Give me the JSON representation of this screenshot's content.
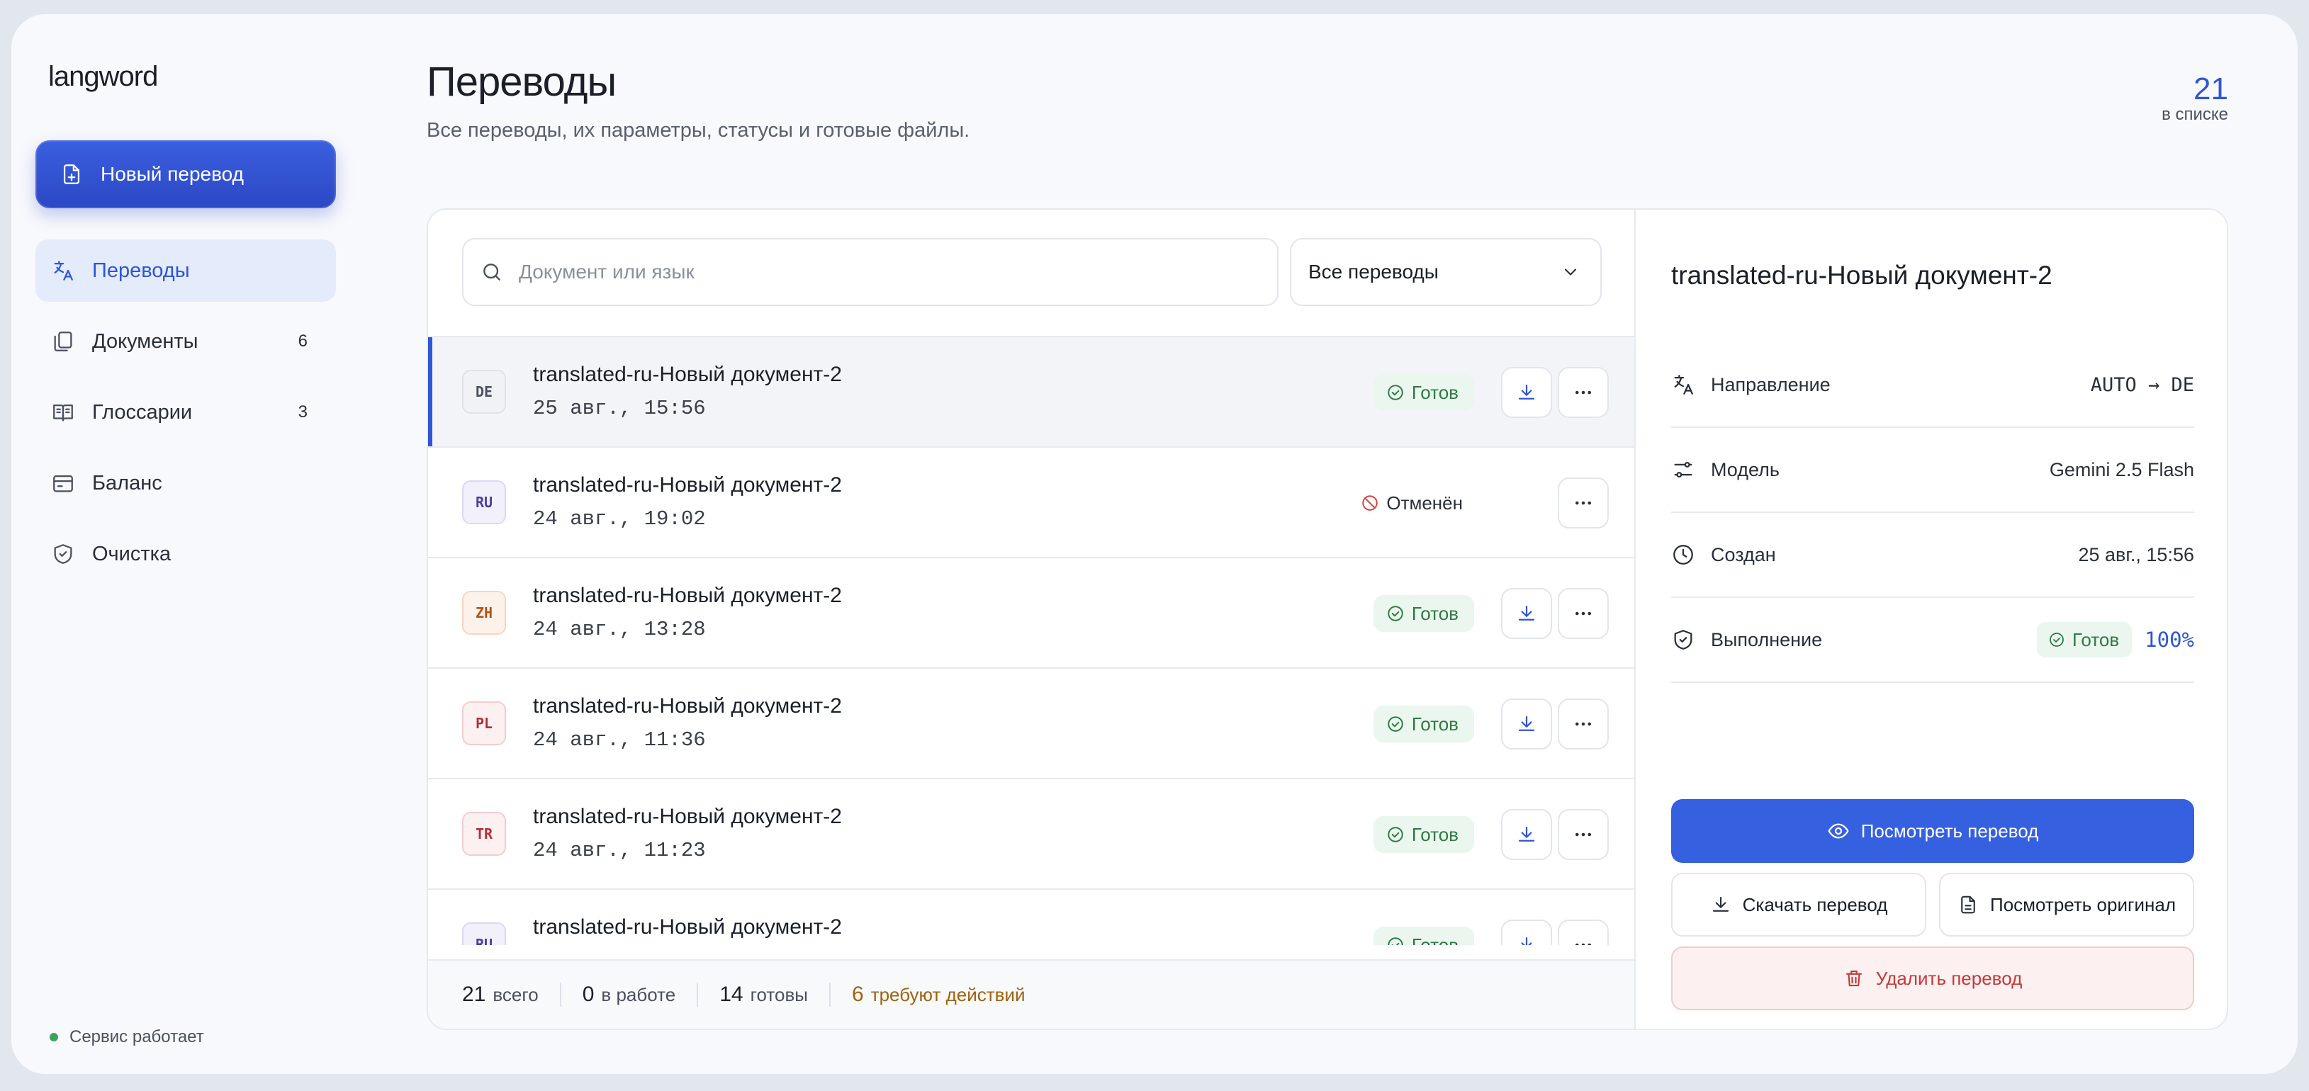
{
  "app": {
    "logo": "langword"
  },
  "sidebar": {
    "new_button": "Новый перевод",
    "items": [
      {
        "label": "Переводы",
        "count": "",
        "icon": "translate-icon",
        "active": true
      },
      {
        "label": "Документы",
        "count": "6",
        "icon": "documents-icon"
      },
      {
        "label": "Глоссарии",
        "count": "3",
        "icon": "book-icon"
      },
      {
        "label": "Баланс",
        "count": "",
        "icon": "wallet-icon"
      },
      {
        "label": "Очистка",
        "count": "",
        "icon": "shield-icon"
      }
    ],
    "status": "Сервис работает"
  },
  "header": {
    "title": "Переводы",
    "subtitle": "Все переводы, их параметры, статусы и готовые файлы.",
    "count": "21",
    "count_label": "в списке"
  },
  "search": {
    "placeholder": "Документ или язык",
    "value": ""
  },
  "filter": {
    "selected": "Все переводы"
  },
  "rows": [
    {
      "lang": "DE",
      "name": "translated-ru-Новый документ-2",
      "date": "25 авг., 15:56",
      "status": "Готов",
      "state": "ready",
      "lang_bg": "#f1f2f5",
      "lang_fg": "#4a5060",
      "lang_border": "#dfe2e8"
    },
    {
      "lang": "RU",
      "name": "translated-ru-Новый документ-2",
      "date": "24 авг., 19:02",
      "status": "Отменён",
      "state": "canceled",
      "lang_bg": "#f1f0fb",
      "lang_fg": "#4b3fa0",
      "lang_border": "#dcd8f4"
    },
    {
      "lang": "ZH",
      "name": "translated-ru-Новый документ-2",
      "date": "24 авг., 13:28",
      "status": "Готов",
      "state": "ready",
      "lang_bg": "#fdf2ea",
      "lang_fg": "#b0541a",
      "lang_border": "#f5d6bf"
    },
    {
      "lang": "PL",
      "name": "translated-ru-Новый документ-2",
      "date": "24 авг., 11:36",
      "status": "Готов",
      "state": "ready",
      "lang_bg": "#fcf0f1",
      "lang_fg": "#b0303c",
      "lang_border": "#f3cdd1"
    },
    {
      "lang": "TR",
      "name": "translated-ru-Новый документ-2",
      "date": "24 авг., 11:23",
      "status": "Готов",
      "state": "ready",
      "lang_bg": "#fcf0f1",
      "lang_fg": "#b0303c",
      "lang_border": "#f3cdd1"
    },
    {
      "lang": "RU",
      "name": "translated-ru-Новый документ-2",
      "date": "",
      "status": "Готов",
      "state": "ready",
      "lang_bg": "#f1f0fb",
      "lang_fg": "#4b3fa0",
      "lang_border": "#dcd8f4"
    }
  ],
  "footer": {
    "total": "21",
    "total_label": "всего",
    "in_progress": "0",
    "in_progress_label": "в работе",
    "ready": "14",
    "ready_label": "готовы",
    "needs_action": "6",
    "needs_action_label": "требуют действий"
  },
  "detail": {
    "title": "translated-ru-Новый документ-2",
    "direction_label": "Направление",
    "direction_value": "AUTO → DE",
    "model_label": "Модель",
    "model_value": "Gemini 2.5 Flash",
    "created_label": "Создан",
    "created_value": "25 авг., 15:56",
    "progress_label": "Выполнение",
    "progress_status": "Готов",
    "progress_value": "100%",
    "view_button": "Посмотреть перевод",
    "download_button": "Скачать перевод",
    "original_button": "Посмотреть оригинал",
    "delete_button": "Удалить перевод"
  },
  "colors": {
    "accent": "#3560e0",
    "ready": "#2f7a45",
    "warn": "#a0620e",
    "danger": "#c23a3a"
  }
}
